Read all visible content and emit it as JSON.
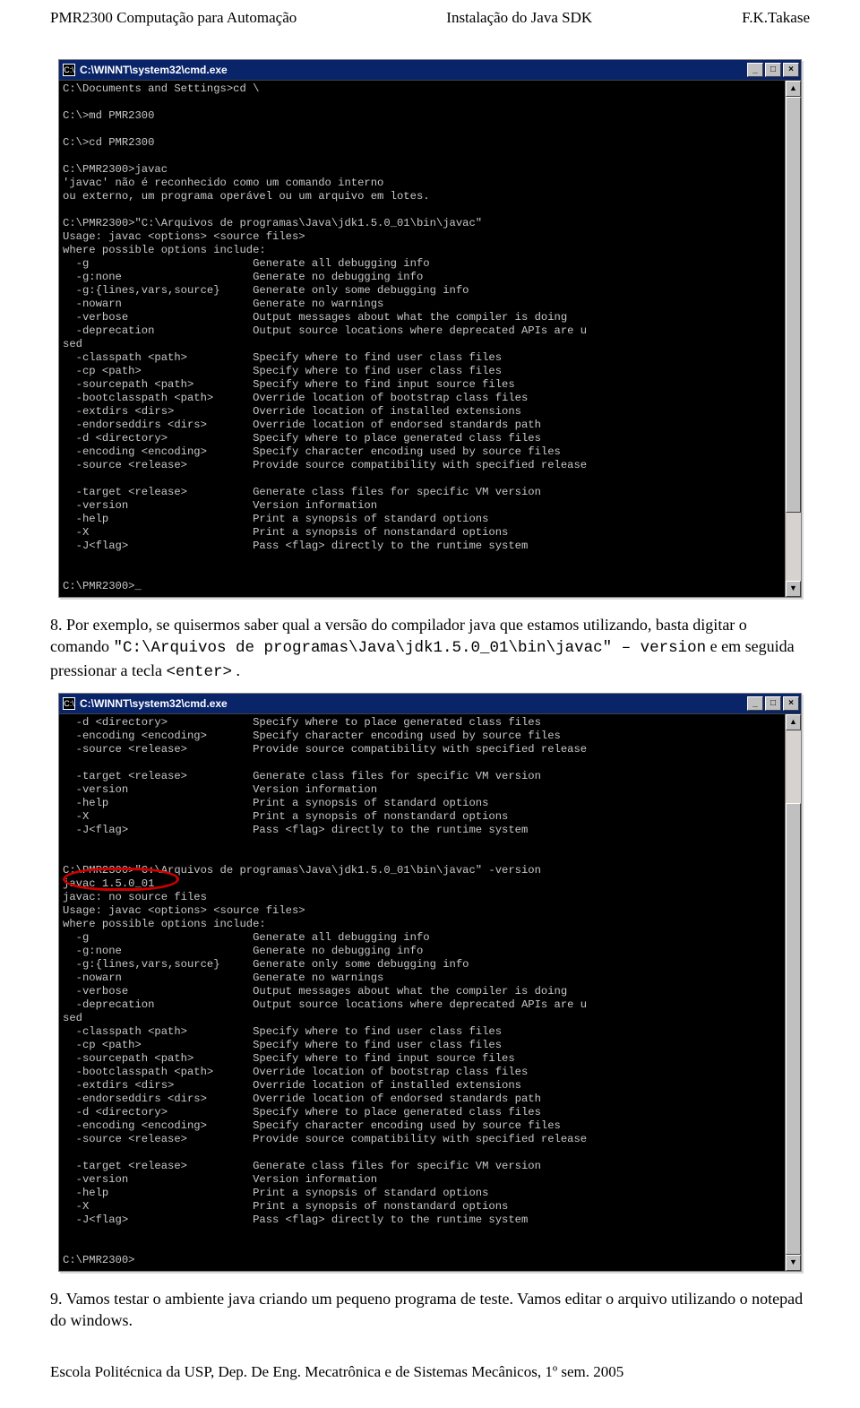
{
  "hdr": {
    "left": "PMR2300 Computação para Automação",
    "mid": "Instalação do Java SDK",
    "right": "F.K.Takase"
  },
  "term1": {
    "title": "C:\\WINNT\\system32\\cmd.exe",
    "body": "C:\\Documents and Settings>cd \\\n\nC:\\>md PMR2300\n\nC:\\>cd PMR2300\n\nC:\\PMR2300>javac\n'javac' não é reconhecido como um comando interno\nou externo, um programa operável ou um arquivo em lotes.\n\nC:\\PMR2300>\"C:\\Arquivos de programas\\Java\\jdk1.5.0_01\\bin\\javac\"\nUsage: javac <options> <source files>\nwhere possible options include:\n  -g                         Generate all debugging info\n  -g:none                    Generate no debugging info\n  -g:{lines,vars,source}     Generate only some debugging info\n  -nowarn                    Generate no warnings\n  -verbose                   Output messages about what the compiler is doing\n  -deprecation               Output source locations where deprecated APIs are u\nsed\n  -classpath <path>          Specify where to find user class files\n  -cp <path>                 Specify where to find user class files\n  -sourcepath <path>         Specify where to find input source files\n  -bootclasspath <path>      Override location of bootstrap class files\n  -extdirs <dirs>            Override location of installed extensions\n  -endorseddirs <dirs>       Override location of endorsed standards path\n  -d <directory>             Specify where to place generated class files\n  -encoding <encoding>       Specify character encoding used by source files\n  -source <release>          Provide source compatibility with specified release\n\n  -target <release>          Generate class files for specific VM version\n  -version                   Version information\n  -help                      Print a synopsis of standard options\n  -X                         Print a synopsis of nonstandard options\n  -J<flag>                   Pass <flag> directly to the runtime system\n\n\nC:\\PMR2300>_"
  },
  "para1": {
    "num": "8.",
    "t1": "Por exemplo, se quisermos saber qual a versão do compilador java que estamos utilizando, basta digitar o comando ",
    "code1": "\"C:\\Arquivos de programas\\Java\\jdk1.5.0_01\\bin\\javac\" – version",
    "t2": " e em seguida pressionar a tecla ",
    "code2": "<enter>",
    "t3": "."
  },
  "term2": {
    "title": "C:\\WINNT\\system32\\cmd.exe",
    "body": "  -d <directory>             Specify where to place generated class files\n  -encoding <encoding>       Specify character encoding used by source files\n  -source <release>          Provide source compatibility with specified release\n\n  -target <release>          Generate class files for specific VM version\n  -version                   Version information\n  -help                      Print a synopsis of standard options\n  -X                         Print a synopsis of nonstandard options\n  -J<flag>                   Pass <flag> directly to the runtime system\n\n\nC:\\PMR2300>\"C:\\Arquivos de programas\\Java\\jdk1.5.0_01\\bin\\javac\" -version\njavac 1.5.0_01\njavac: no source files\nUsage: javac <options> <source files>\nwhere possible options include:\n  -g                         Generate all debugging info\n  -g:none                    Generate no debugging info\n  -g:{lines,vars,source}     Generate only some debugging info\n  -nowarn                    Generate no warnings\n  -verbose                   Output messages about what the compiler is doing\n  -deprecation               Output source locations where deprecated APIs are u\nsed\n  -classpath <path>          Specify where to find user class files\n  -cp <path>                 Specify where to find user class files\n  -sourcepath <path>         Specify where to find input source files\n  -bootclasspath <path>      Override location of bootstrap class files\n  -extdirs <dirs>            Override location of installed extensions\n  -endorseddirs <dirs>       Override location of endorsed standards path\n  -d <directory>             Specify where to place generated class files\n  -encoding <encoding>       Specify character encoding used by source files\n  -source <release>          Provide source compatibility with specified release\n\n  -target <release>          Generate class files for specific VM version\n  -version                   Version information\n  -help                      Print a synopsis of standard options\n  -X                         Print a synopsis of nonstandard options\n  -J<flag>                   Pass <flag> directly to the runtime system\n\n\nC:\\PMR2300>"
  },
  "para2": {
    "num": "9.",
    "t1": "Vamos testar o ambiente java criando um pequeno programa de teste. Vamos editar o arquivo utilizando o notepad do windows."
  },
  "footer": "Escola Politécnica da USP, Dep. De Eng. Mecatrônica e de Sistemas Mecânicos, 1º sem. 2005"
}
